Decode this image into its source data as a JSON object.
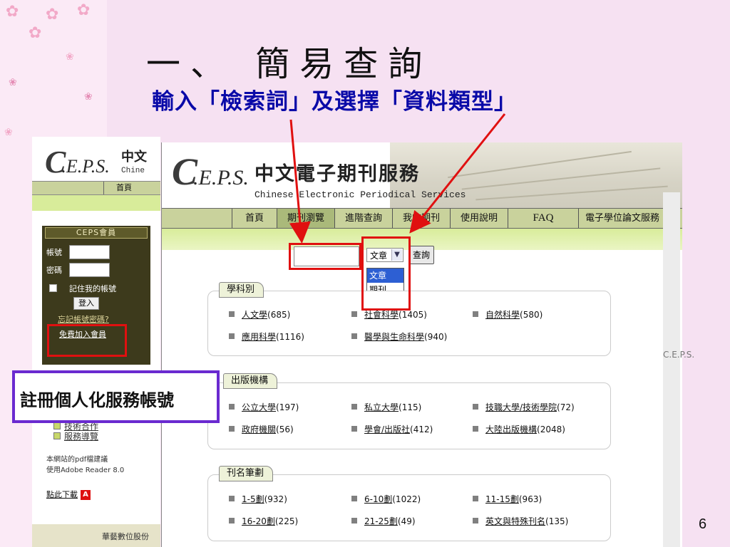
{
  "slide": {
    "title": "一、 簡易查詢",
    "subtitle": "輸入「檢索詞」及選擇「資料類型」",
    "page_number": "6",
    "callout": "註冊個人化服務帳號"
  },
  "back_screen": {
    "logo": ".E.P.S.",
    "brand_cn": "中文",
    "brand_en": "Chine",
    "nav_home": "首頁",
    "member": {
      "header": "CEPS會員",
      "account_label": "帳號",
      "password_label": "密碼",
      "remember": "記住我的帳號",
      "login": "登入",
      "forgot": "忘記帳號密碼?",
      "join": "免費加入會員"
    },
    "links": [
      "技術合作",
      "服務導覽"
    ],
    "pdf_note_1": "本網站的pdf檔建議",
    "pdf_note_2": "使用Adobe Reader 8.0",
    "download": "點此下載",
    "footer": "華藝數位股份"
  },
  "front_screen": {
    "logo": ".E.P.S.",
    "brand_cn": "中文電子期刊服務",
    "brand_en": "Chinese Electronic Periodical Services",
    "nav": [
      "首頁",
      "期刊瀏覽",
      "進階查詢",
      "我的期刊",
      "使用說明",
      "FAQ",
      "電子學位論文服務"
    ],
    "search": {
      "selected_type": "文章",
      "options": [
        "文章",
        "期刊"
      ],
      "button": "查詢"
    },
    "subject": {
      "title": "學科別",
      "items": [
        {
          "name": "人文學",
          "count": "(685)"
        },
        {
          "name": "社會科學",
          "count": "(1405)"
        },
        {
          "name": "自然科學",
          "count": "(580)"
        },
        {
          "name": "應用科學",
          "count": "(1116)"
        },
        {
          "name": "醫學與生命科學",
          "count": "(940)"
        }
      ]
    },
    "publisher": {
      "title": "出版機構",
      "items": [
        {
          "name": "公立大學",
          "count": "(197)"
        },
        {
          "name": "私立大學",
          "count": "(115)"
        },
        {
          "name": "技職大學/技術學院",
          "count": "(72)"
        },
        {
          "name": "政府機關",
          "count": "(56)"
        },
        {
          "name": "學會/出版社",
          "count": "(412)"
        },
        {
          "name": "大陸出版機構",
          "count": "(2048)"
        }
      ]
    },
    "strokes": {
      "title": "刊名筆劃",
      "items": [
        {
          "name": "1-5劃",
          "count": "(932)"
        },
        {
          "name": "6-10劃",
          "count": "(1022)"
        },
        {
          "name": "11-15劃",
          "count": "(963)"
        },
        {
          "name": "16-20劃",
          "count": "(225)"
        },
        {
          "name": "21-25劃",
          "count": "(49)"
        },
        {
          "name": "英文與特殊刊名",
          "count": "(135)"
        }
      ]
    },
    "side_mark": "C.E.P.S."
  },
  "colors": {
    "background": "#f6e1f2",
    "title_blue": "#0a0aa8",
    "annotation_red": "#e01010",
    "callout_border": "#6a2ad0",
    "nav_green": "#c9d29c"
  },
  "icons": [
    "petal-icon",
    "dropdown-arrow-icon",
    "bullet-square-icon",
    "adobe-pdf-icon"
  ]
}
